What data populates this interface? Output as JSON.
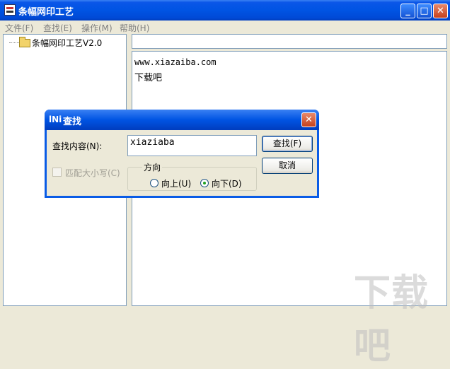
{
  "window": {
    "title": "条幅网印工艺",
    "minimize": "_",
    "maximize": "□",
    "close": "✕"
  },
  "menu": [
    "文件(F)",
    "查找(E)",
    "操作(M)",
    "帮助(H)"
  ],
  "tree": {
    "root_label": "条幅网印工艺V2.0"
  },
  "content": {
    "path": "",
    "lines": [
      "www.xiazaiba.com",
      "下载吧"
    ]
  },
  "dialog": {
    "title": "查找",
    "icon_text": "lNi",
    "find_label": "查找内容(N):",
    "find_value": "xiaziaba",
    "find_button": "查找(F)",
    "cancel_button": "取消",
    "match_case": {
      "label": "匹配大小写(C)",
      "checked": false,
      "enabled": false
    },
    "direction": {
      "legend": "方向",
      "up_label": "向上(U)",
      "down_label": "向下(D)",
      "selected": "down"
    }
  },
  "watermark": "下载吧"
}
